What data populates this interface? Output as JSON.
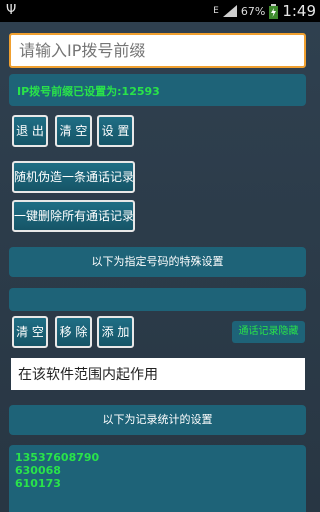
{
  "statusbar": {
    "battery_percent": "67%",
    "time": "1:49",
    "network_label": "E",
    "icons": [
      "usb-icon",
      "signal-icon",
      "battery-icon"
    ]
  },
  "ip_prefix_input": {
    "placeholder": "请输入IP拨号前缀",
    "value": ""
  },
  "ip_status": "IP拨号前缀已设置为:12593",
  "top_buttons": {
    "exit": "退 出",
    "clear": "清 空",
    "settings": "设 置"
  },
  "random_record_button": "随机伪造一条通话记录",
  "delete_all_button": "一键删除所有通话记录",
  "special_settings_bar": "以下为指定号码的特殊设置",
  "number_bar_text": "",
  "number_buttons": {
    "clear": "清 空",
    "remove": "移 除",
    "add": "添 加"
  },
  "hide_records_button": "通话记录隐藏",
  "scope_input": {
    "value": "在该软件范围内起作用"
  },
  "stats_settings_bar": "以下为记录统计的设置",
  "records": [
    "13537608790",
    "630068",
    "610173"
  ],
  "colors": {
    "accent_teal": "#1e6378",
    "green_text": "#29e34a",
    "input_border": "#f0a030"
  }
}
